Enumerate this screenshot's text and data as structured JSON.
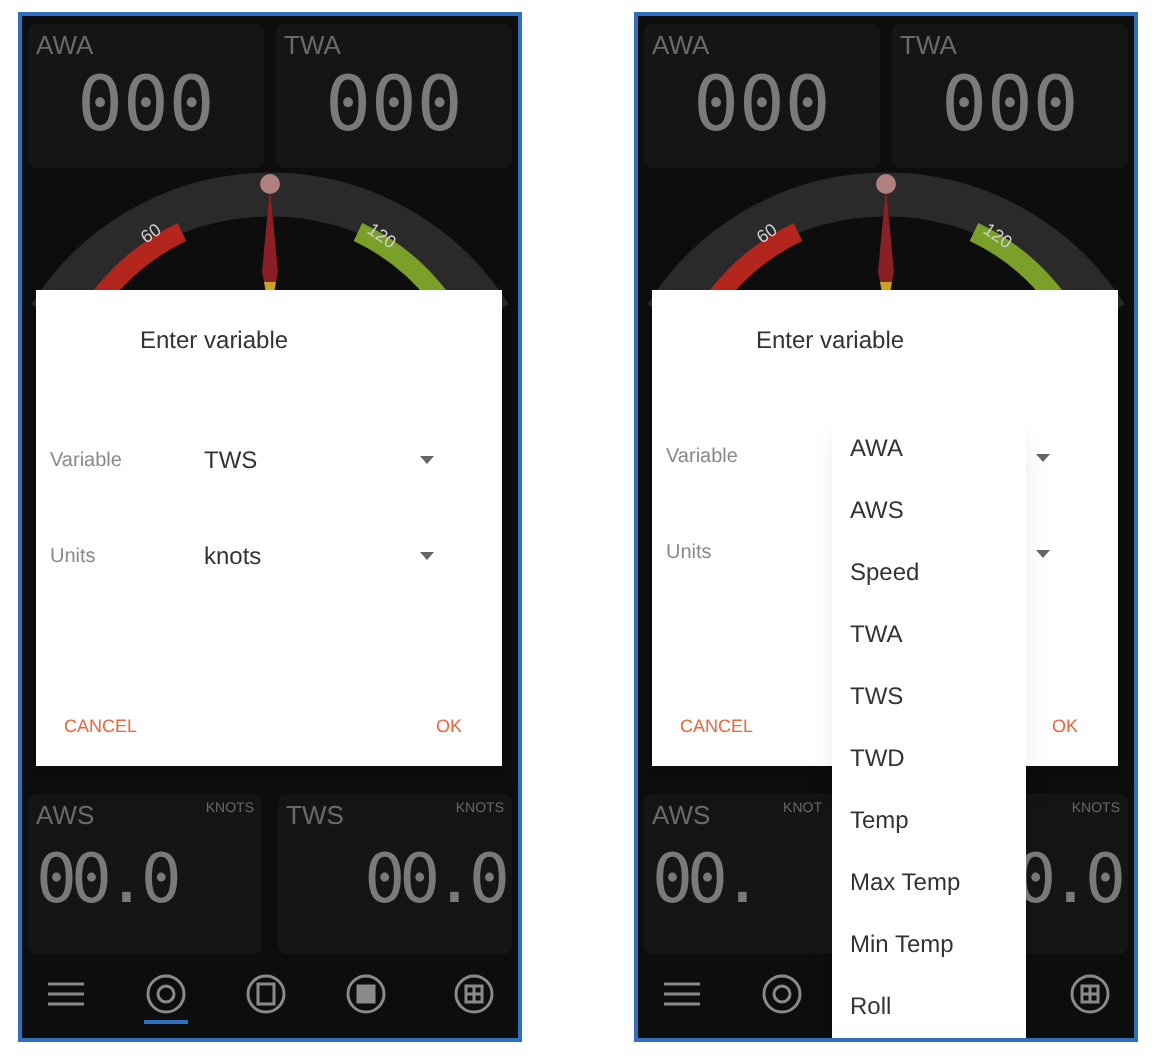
{
  "screens": [
    {
      "top_tiles": [
        {
          "label": "AWA",
          "value": "000"
        },
        {
          "label": "TWA",
          "value": "000"
        }
      ],
      "gauge": {
        "labels": [
          "60",
          "120"
        ]
      },
      "dialog": {
        "title": "Enter variable",
        "fields": [
          {
            "label": "Variable",
            "value": "TWS"
          },
          {
            "label": "Units",
            "value": "knots"
          }
        ],
        "cancel": "CANCEL",
        "ok": "OK"
      },
      "bottom_tiles": [
        {
          "label": "AWS",
          "unit": "KNOTS",
          "value": "00.0"
        },
        {
          "label": "TWS",
          "unit": "KNOTS",
          "value": "00.0"
        }
      ],
      "nav": [
        {
          "kind": "menu",
          "selected": false
        },
        {
          "kind": "target",
          "selected": true
        },
        {
          "kind": "book",
          "selected": false
        },
        {
          "kind": "square",
          "selected": false
        },
        {
          "kind": "grid",
          "selected": false
        }
      ]
    },
    {
      "top_tiles": [
        {
          "label": "AWA",
          "value": "000"
        },
        {
          "label": "TWA",
          "value": "000"
        }
      ],
      "gauge": {
        "labels": [
          "60",
          "120"
        ]
      },
      "dialog": {
        "title": "Enter variable",
        "fields": [
          {
            "label": "Variable"
          },
          {
            "label": "Units"
          }
        ],
        "cancel": "CANCEL",
        "ok": "OK"
      },
      "bottom_tiles": [
        {
          "label": "AWS",
          "unit": "KNOT",
          "value": "00."
        },
        {
          "unit": "KNOTS",
          "value": "0.0"
        }
      ],
      "nav": [
        {
          "kind": "menu",
          "selected": false
        },
        {
          "kind": "target",
          "selected": false
        },
        {
          "kind": "grid",
          "selected": false
        }
      ],
      "dropdown": [
        "AWA",
        "AWS",
        "Speed",
        "TWA",
        "TWS",
        "TWD",
        "Temp",
        "Max Temp",
        "Min Temp",
        "Roll"
      ]
    }
  ]
}
